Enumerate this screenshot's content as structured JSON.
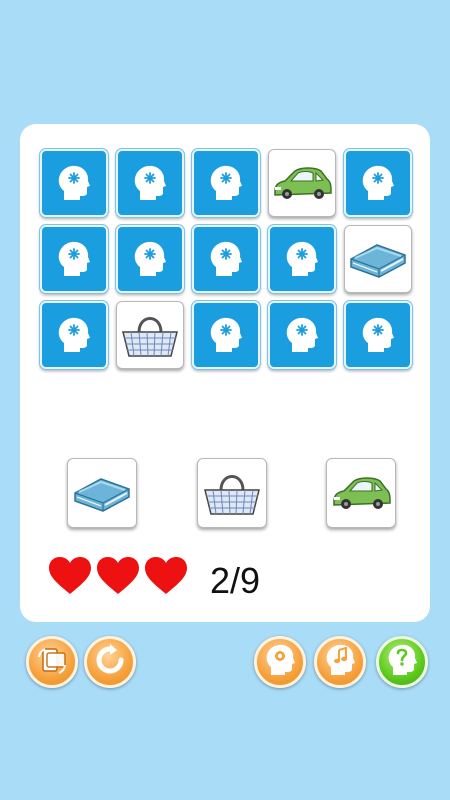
{
  "board": {
    "rows": 3,
    "cols": 5,
    "cards": [
      {
        "state": "hidden",
        "icon": "brain-head-icon"
      },
      {
        "state": "hidden",
        "icon": "brain-head-icon"
      },
      {
        "state": "hidden",
        "icon": "brain-head-icon"
      },
      {
        "state": "revealed",
        "icon": "car-icon"
      },
      {
        "state": "hidden",
        "icon": "brain-head-icon"
      },
      {
        "state": "hidden",
        "icon": "brain-head-icon"
      },
      {
        "state": "hidden",
        "icon": "brain-head-icon"
      },
      {
        "state": "hidden",
        "icon": "brain-head-icon"
      },
      {
        "state": "hidden",
        "icon": "brain-head-icon"
      },
      {
        "state": "revealed",
        "icon": "book-icon"
      },
      {
        "state": "hidden",
        "icon": "brain-head-icon"
      },
      {
        "state": "revealed",
        "icon": "basket-icon"
      },
      {
        "state": "hidden",
        "icon": "brain-head-icon"
      },
      {
        "state": "hidden",
        "icon": "brain-head-icon"
      },
      {
        "state": "hidden",
        "icon": "brain-head-icon"
      }
    ]
  },
  "targets": [
    {
      "icon": "book-icon"
    },
    {
      "icon": "basket-icon"
    },
    {
      "icon": "car-icon"
    }
  ],
  "status": {
    "lives": 3,
    "score_text": "2/9"
  },
  "toolbar": [
    {
      "icon": "rotate-device-icon",
      "color": "orange"
    },
    {
      "icon": "restart-icon",
      "color": "orange"
    },
    {
      "icon": "settings-head-icon",
      "color": "orange"
    },
    {
      "icon": "music-head-icon",
      "color": "orange"
    },
    {
      "icon": "help-head-icon",
      "color": "green"
    }
  ],
  "colors": {
    "background": "#a9dcf7",
    "card_back": "#1a9ee0",
    "heart": "#ee1111",
    "orange_button": "#f6a13c",
    "green_button": "#5cc91d"
  }
}
